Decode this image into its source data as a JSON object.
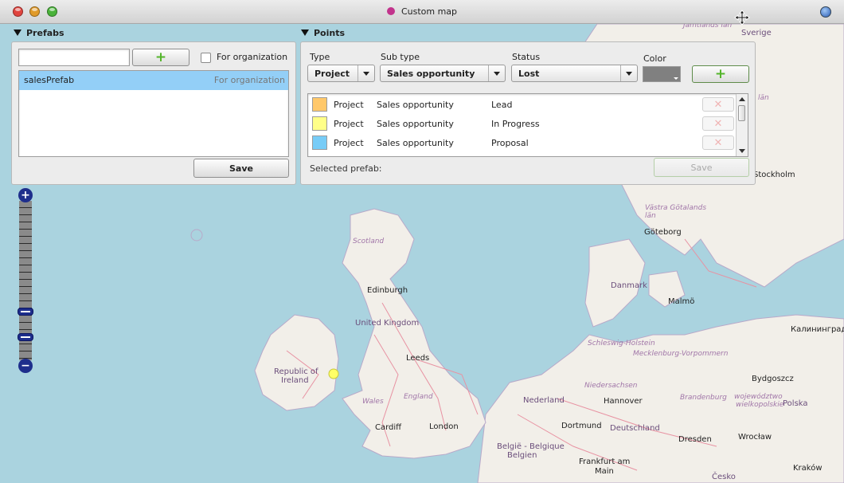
{
  "window": {
    "title": "Custom map"
  },
  "prefabs": {
    "header": "Prefabs",
    "name_value": "",
    "for_org_label": "For organization",
    "items": [
      {
        "name": "salesPrefab",
        "tag": "For organization"
      }
    ],
    "save_label": "Save"
  },
  "points": {
    "header": "Points",
    "type_label": "Type",
    "subtype_label": "Sub type",
    "status_label": "Status",
    "color_label": "Color",
    "type_value": "Project",
    "subtype_value": "Sales opportunity",
    "status_value": "Lost",
    "color_value": "#808080",
    "rows": [
      {
        "type": "Project",
        "subtype": "Sales opportunity",
        "status": "Lead",
        "color": "#ffc86a"
      },
      {
        "type": "Project",
        "subtype": "Sales opportunity",
        "status": "In Progress",
        "color": "#ffff88"
      },
      {
        "type": "Project",
        "subtype": "Sales opportunity",
        "status": "Proposal",
        "color": "#77ccf7"
      }
    ],
    "selected_prefab_label": "Selected prefab:",
    "save_label": "Save"
  },
  "map": {
    "labels": {
      "sverige": "Sverige",
      "jamtland": "Jämtlands län",
      "lan": "län",
      "stockholm": "Stockholm",
      "vastra": "Västra Götalands län",
      "goteborg": "Göteborg",
      "danmark": "Danmark",
      "malmo": "Malmö",
      "kaliningrad": "Калининград",
      "scotland": "Scotland",
      "edinburgh": "Edinburgh",
      "uk": "United Kingdom",
      "leeds": "Leeds",
      "england": "England",
      "wales": "Wales",
      "cardiff": "Cardiff",
      "london": "London",
      "ireland1": "Republic of",
      "ireland2": "Ireland",
      "schleswig": "Schleswig-Holstein",
      "mecklenburg": "Mecklenburg-Vorpommern",
      "niedersachsen": "Niedersachsen",
      "nederland": "Nederland",
      "hannover": "Hannover",
      "brandenburg": "Brandenburg",
      "deutschland": "Deutschland",
      "dortmund": "Dortmund",
      "dresden": "Dresden",
      "bydgoszcz": "Bydgoszcz",
      "woj1": "województwo",
      "woj2": "wielkopolskie",
      "polska": "Polska",
      "wroclaw": "Wrocław",
      "belgique1": "België - Belgique",
      "belgique2": "Belgien",
      "frankfurt1": "Frankfurt am",
      "frankfurt2": "Main",
      "krakow": "Kraków",
      "cesko": "Česko"
    }
  }
}
